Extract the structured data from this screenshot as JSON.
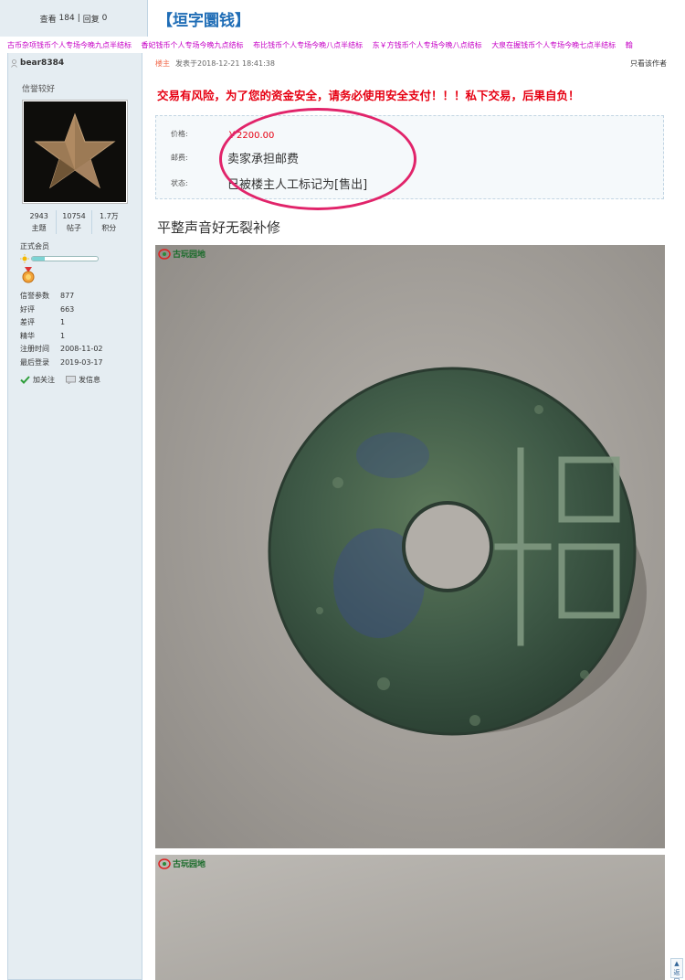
{
  "header": {
    "views_label": "查看",
    "views": "184",
    "separator": "|",
    "replies_label": "回复",
    "replies": "0",
    "thread_title": "【垣字圜钱】"
  },
  "ads": [
    "古币杂项钱币个人专场今晚九点半结标",
    "香妃钱币个人专场今晚九点结标",
    "布比钱币个人专场今晚八点半结标",
    "东￥方钱币个人专场今晚八点结标",
    "大泉在握钱币个人专场今晚七点半结标",
    "翰"
  ],
  "user": {
    "name": "bear8384",
    "credit_text": "信誉较好",
    "stats": [
      {
        "value": "2943",
        "label": "主题"
      },
      {
        "value": "10754",
        "label": "帖子"
      },
      {
        "value": "1.7万",
        "label": "积分"
      }
    ],
    "member_group": "正式会员",
    "level_fraction": 0.2,
    "profile": [
      {
        "k": "信誉参数",
        "v": "877"
      },
      {
        "k": "好评",
        "v": "663"
      },
      {
        "k": "差评",
        "v": "1"
      },
      {
        "k": "精华",
        "v": "1"
      },
      {
        "k": "注册时间",
        "v": "2008-11-02"
      },
      {
        "k": "最后登录",
        "v": "2019-03-17"
      }
    ],
    "follow_label": "加关注",
    "message_label": "发信息"
  },
  "post": {
    "owner_tag": "楼主",
    "posted_at": "发表于2018-12-21 18:41:38",
    "only_author": "只看该作者",
    "warning": "交易有风险，为了您的资金安全，请务必使用安全支付！！！私下交易，后果自负！",
    "trade": {
      "price_label": "价格:",
      "price": "￥2200.00",
      "shipping_label": "邮费:",
      "shipping": "卖家承担邮费",
      "status_label": "状态:",
      "status": "已被楼主人工标记为",
      "status_tag": "[售出]"
    },
    "description": "平整声音好无裂补修",
    "watermark": "古玩园地"
  },
  "scroll_top_label": "返回"
}
